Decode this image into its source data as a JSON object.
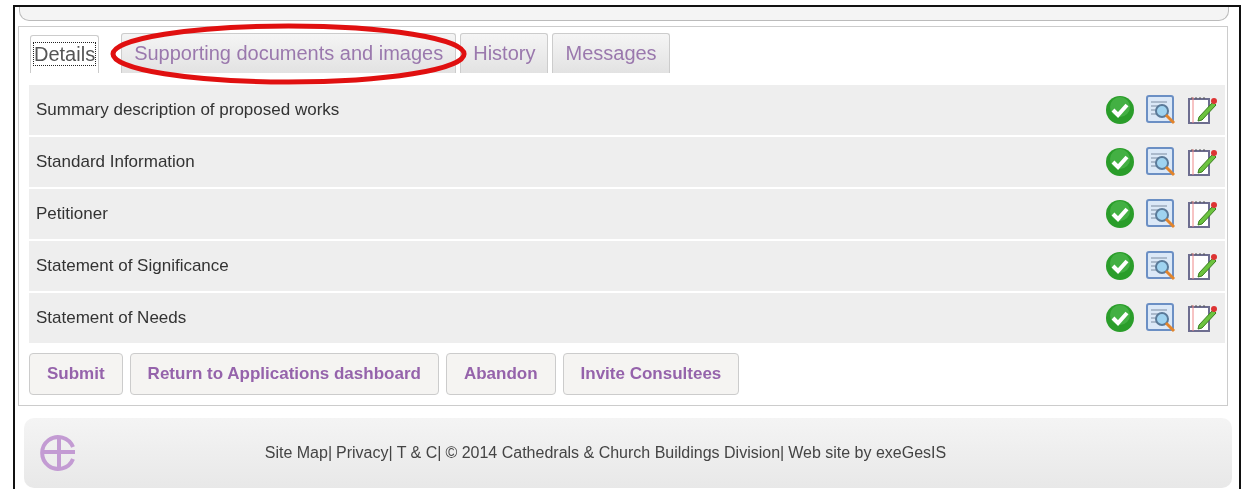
{
  "tabs": [
    {
      "label": "Details",
      "selected": true
    },
    {
      "label": "Supporting documents and images",
      "selected": false,
      "circled": true
    },
    {
      "label": "History",
      "selected": false
    },
    {
      "label": "Messages",
      "selected": false
    }
  ],
  "sections": [
    {
      "title": "Summary description of proposed works",
      "complete": true
    },
    {
      "title": "Standard Information",
      "complete": true
    },
    {
      "title": "Petitioner",
      "complete": true
    },
    {
      "title": "Statement of Significance",
      "complete": true
    },
    {
      "title": "Statement of Needs",
      "complete": true
    }
  ],
  "buttons": [
    "Submit",
    "Return to Applications dashboard",
    "Abandon",
    "Invite Consultees"
  ],
  "footer": [
    {
      "kind": "link",
      "text": "Site Map"
    },
    {
      "kind": "sep",
      "text": "|"
    },
    {
      "kind": "link",
      "text": "Privacy"
    },
    {
      "kind": "sep",
      "text": "|"
    },
    {
      "kind": "link",
      "text": "T & C"
    },
    {
      "kind": "sep",
      "text": "|"
    },
    {
      "kind": "text",
      "text": "© 2014 Cathedrals & Church Buildings Division"
    },
    {
      "kind": "sep",
      "text": "|"
    },
    {
      "kind": "text",
      "text": "Web site by exeGesIS"
    }
  ]
}
